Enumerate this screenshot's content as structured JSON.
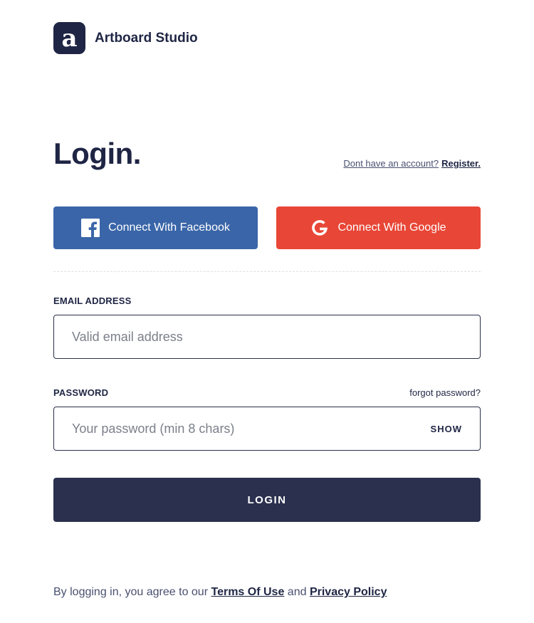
{
  "brand": {
    "logo_letter": "a",
    "name": "Artboard Studio"
  },
  "title": "Login.",
  "register": {
    "question": "Dont have an account?",
    "link": "Register."
  },
  "social": {
    "facebook": {
      "label": "Connect With Facebook",
      "icon": "facebook-icon",
      "color": "#3a65a8"
    },
    "google": {
      "label": "Connect With Google",
      "icon": "google-icon",
      "color": "#e84636"
    }
  },
  "form": {
    "email": {
      "label": "EMAIL ADDRESS",
      "placeholder": "Valid email address",
      "value": ""
    },
    "password": {
      "label": "PASSWORD",
      "forgot": "forgot password?",
      "placeholder": "Your password (min 8 chars)",
      "value": "",
      "toggle": "SHOW"
    },
    "submit_label": "LOGIN"
  },
  "legal": {
    "prefix": "By logging in, you agree to our",
    "terms": "Terms Of Use",
    "conjunction": "and",
    "privacy": "Privacy Policy"
  },
  "colors": {
    "primary": "#2a304e",
    "text": "#1f2544"
  }
}
